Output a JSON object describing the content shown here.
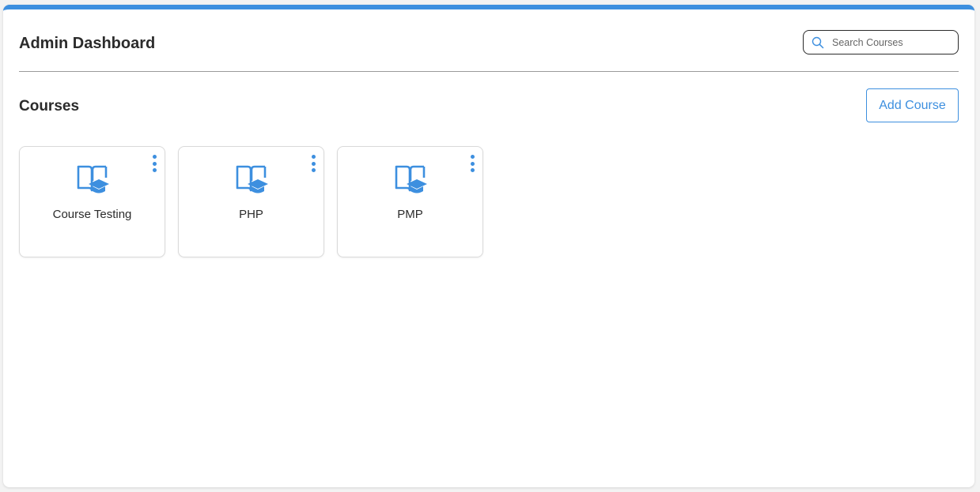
{
  "header": {
    "title": "Admin Dashboard",
    "search": {
      "placeholder": "Search Courses",
      "value": ""
    }
  },
  "section": {
    "title": "Courses",
    "add_label": "Add Course"
  },
  "courses": [
    {
      "name": "Course Testing",
      "icon": "book-graduation-icon"
    },
    {
      "name": "PHP",
      "icon": "book-graduation-icon"
    },
    {
      "name": "PMP",
      "icon": "book-graduation-icon"
    }
  ],
  "colors": {
    "accent": "#3d8fdf",
    "text": "#2b2b2b",
    "border": "#dadada"
  }
}
